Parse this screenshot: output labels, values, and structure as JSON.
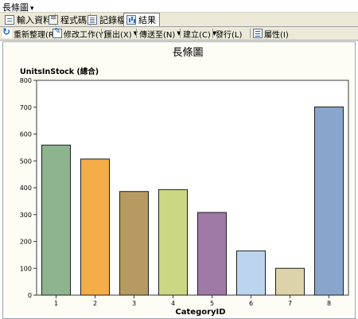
{
  "window": {
    "title": "長條圖"
  },
  "tabs": [
    {
      "label": "輸入資料"
    },
    {
      "label": "程式碼"
    },
    {
      "label": "記錄檔"
    },
    {
      "label": "結果"
    }
  ],
  "toolbar": {
    "refresh": "重新整理(R)",
    "modify_task": "修改工作(Y)",
    "export": "匯出(X)",
    "send_to": "傳送至(N)",
    "create": "建立(C)",
    "publish": "發行(L)",
    "properties": "屬性(I)"
  },
  "chart_data": {
    "type": "bar",
    "title": "長條圖",
    "ylabel": "UnitsInStock (總合)",
    "xlabel": "CategoryID",
    "categories": [
      "1",
      "2",
      "3",
      "4",
      "5",
      "6",
      "7",
      "8"
    ],
    "values": [
      559,
      507,
      386,
      393,
      308,
      165,
      100,
      701
    ],
    "colors": [
      "#8db48f",
      "#f4ad49",
      "#b59a62",
      "#ccd784",
      "#a07aa6",
      "#bdd4ef",
      "#dcd4a8",
      "#88a6cc"
    ],
    "ylim": [
      0,
      800
    ],
    "yticks": [
      0,
      100,
      200,
      300,
      400,
      500,
      600,
      700,
      800
    ],
    "grid": false,
    "legend": "none"
  }
}
